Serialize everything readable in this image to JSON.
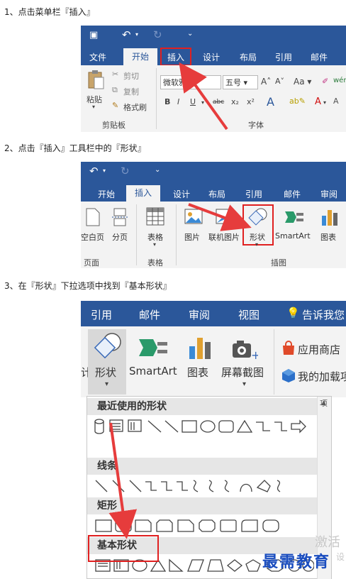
{
  "steps": [
    "1、点击菜单栏『插入』",
    "2、点击『插入』工具栏中的『形状』",
    "3、在『形状』下拉选项中找到『基本形状』"
  ],
  "shot1": {
    "tabs": [
      "文件",
      "开始",
      "插入",
      "设计",
      "布局",
      "引用",
      "邮件"
    ],
    "active_tab": "开始",
    "highlight_tab": "插入",
    "paste_label": "粘贴",
    "cut_label": "剪切",
    "copy_label": "复制",
    "format_painter_label": "格式刷",
    "clipboard_group": "剪贴板",
    "font_name": "微软雅黑",
    "font_size": "五号",
    "font_group": "字体",
    "aa_label": "Aa",
    "format_buttons": [
      "B",
      "I",
      "U",
      "abc",
      "x₂",
      "x²"
    ]
  },
  "shot2": {
    "tabs": [
      "开始",
      "插入",
      "设计",
      "布局",
      "引用",
      "邮件",
      "审阅"
    ],
    "active_tab": "插入",
    "blank_page": "空白页",
    "page_break": "分页",
    "page_group": "页面",
    "table_label": "表格",
    "table_group": "表格",
    "picture": "图片",
    "online_picture": "联机图片",
    "shapes": "形状",
    "smartart": "SmartArt",
    "chart": "图表",
    "illustration_group": "插图"
  },
  "shot3": {
    "tabs": [
      "引用",
      "邮件",
      "审阅",
      "视图"
    ],
    "tell_me": "告诉我您",
    "shapes": "形状",
    "smartart": "SmartArt",
    "chart": "图表",
    "screenshot": "屏幕截图",
    "store": "应用商店",
    "my_addins": "我的加载项",
    "left_partial": "计",
    "right_partial": "项",
    "sections": {
      "recent": "最近使用的形状",
      "lines": "线条",
      "rect": "矩形",
      "basic": "基本形状"
    }
  },
  "watermark_grey": "激活",
  "watermark_brand": "最需教育",
  "watermark_tail": "设"
}
